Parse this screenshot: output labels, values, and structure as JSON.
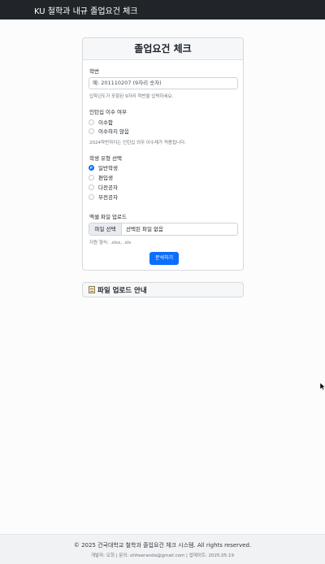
{
  "navbar": {
    "brand": "KU 철학과 내규 졸업요건 체크"
  },
  "form": {
    "title": "졸업요건 체크",
    "student_id": {
      "label": "학번",
      "placeholder": "예: 201110207 (9자리 숫자)",
      "help": "입학년도가 포함된 9자리 학번을 입력하세요."
    },
    "internship": {
      "label": "인턴십 이수 여부",
      "options": [
        "이수함",
        "이수하지 않음"
      ],
      "help": "2024학번까지는 인턴십 의무 이수제가 적용됩니다."
    },
    "student_type": {
      "label": "학생 유형 선택",
      "options": [
        "일반학생",
        "편입생",
        "다전공자",
        "부전공자"
      ],
      "selected": "일반학생"
    },
    "file_upload": {
      "label": "엑셀 파일 업로드",
      "button": "파일 선택",
      "filename": "선택된 파일 없음",
      "help": "지원 형식: .xlsx, .xls"
    },
    "submit_label": "분석하기"
  },
  "guide": {
    "title": "파일 업로드 안내",
    "icon": "memo-icon"
  },
  "footer": {
    "copyright": "© 2025 건국대학교 철학과 졸업요건 체크 시스템. All rights reserved.",
    "credits": "개발자: 오희 | 문의: ohheeranda@gmail.com | 업데이트: 2025.05.19"
  },
  "colors": {
    "navbar": "#212529",
    "accent": "#0d6efd"
  }
}
